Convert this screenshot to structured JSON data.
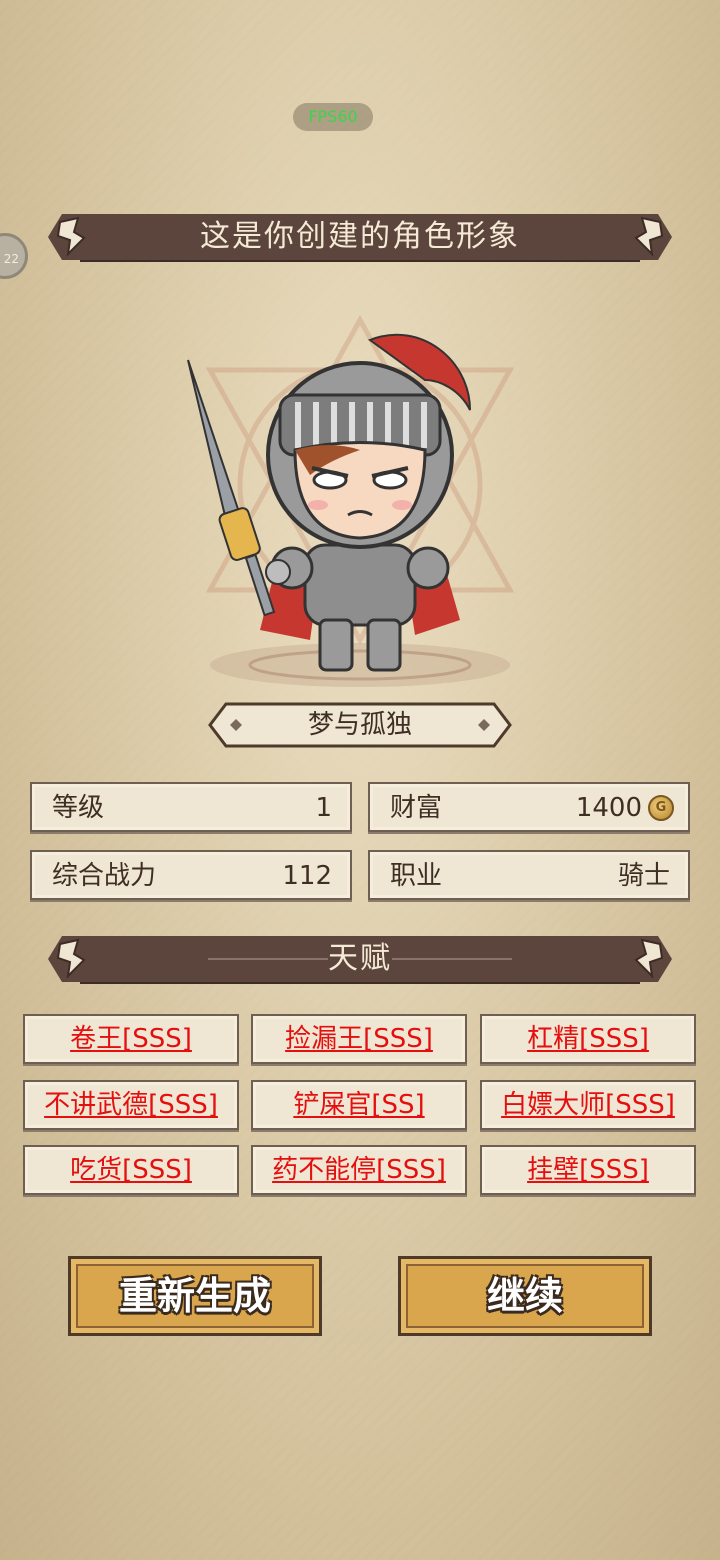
{
  "hud": {
    "fps": "FPS60",
    "side_badge": "22"
  },
  "header": {
    "title": "这是你创建的角色形象"
  },
  "character": {
    "name": "梦与孤独"
  },
  "stats": {
    "level": {
      "label": "等级",
      "value": "1"
    },
    "wealth": {
      "label": "财富",
      "value": "1400"
    },
    "power": {
      "label": "综合战力",
      "value": "112"
    },
    "job": {
      "label": "职业",
      "value": "骑士"
    }
  },
  "talents_header": {
    "title": "天赋"
  },
  "talents": [
    {
      "label": "卷王[SSS]"
    },
    {
      "label": "捡漏王[SSS]"
    },
    {
      "label": "杠精[SSS]"
    },
    {
      "label": "不讲武德[SSS]"
    },
    {
      "label": "铲屎官[SS]"
    },
    {
      "label": "白嫖大师[SSS]"
    },
    {
      "label": "吃货[SSS]"
    },
    {
      "label": "药不能停[SSS]"
    },
    {
      "label": "挂壁[SSS]"
    }
  ],
  "buttons": {
    "regenerate": "重新生成",
    "continue": "继续"
  },
  "colors": {
    "banner": "#5b453c",
    "talent_text": "#e60f0f",
    "button": "#d9a64e"
  }
}
